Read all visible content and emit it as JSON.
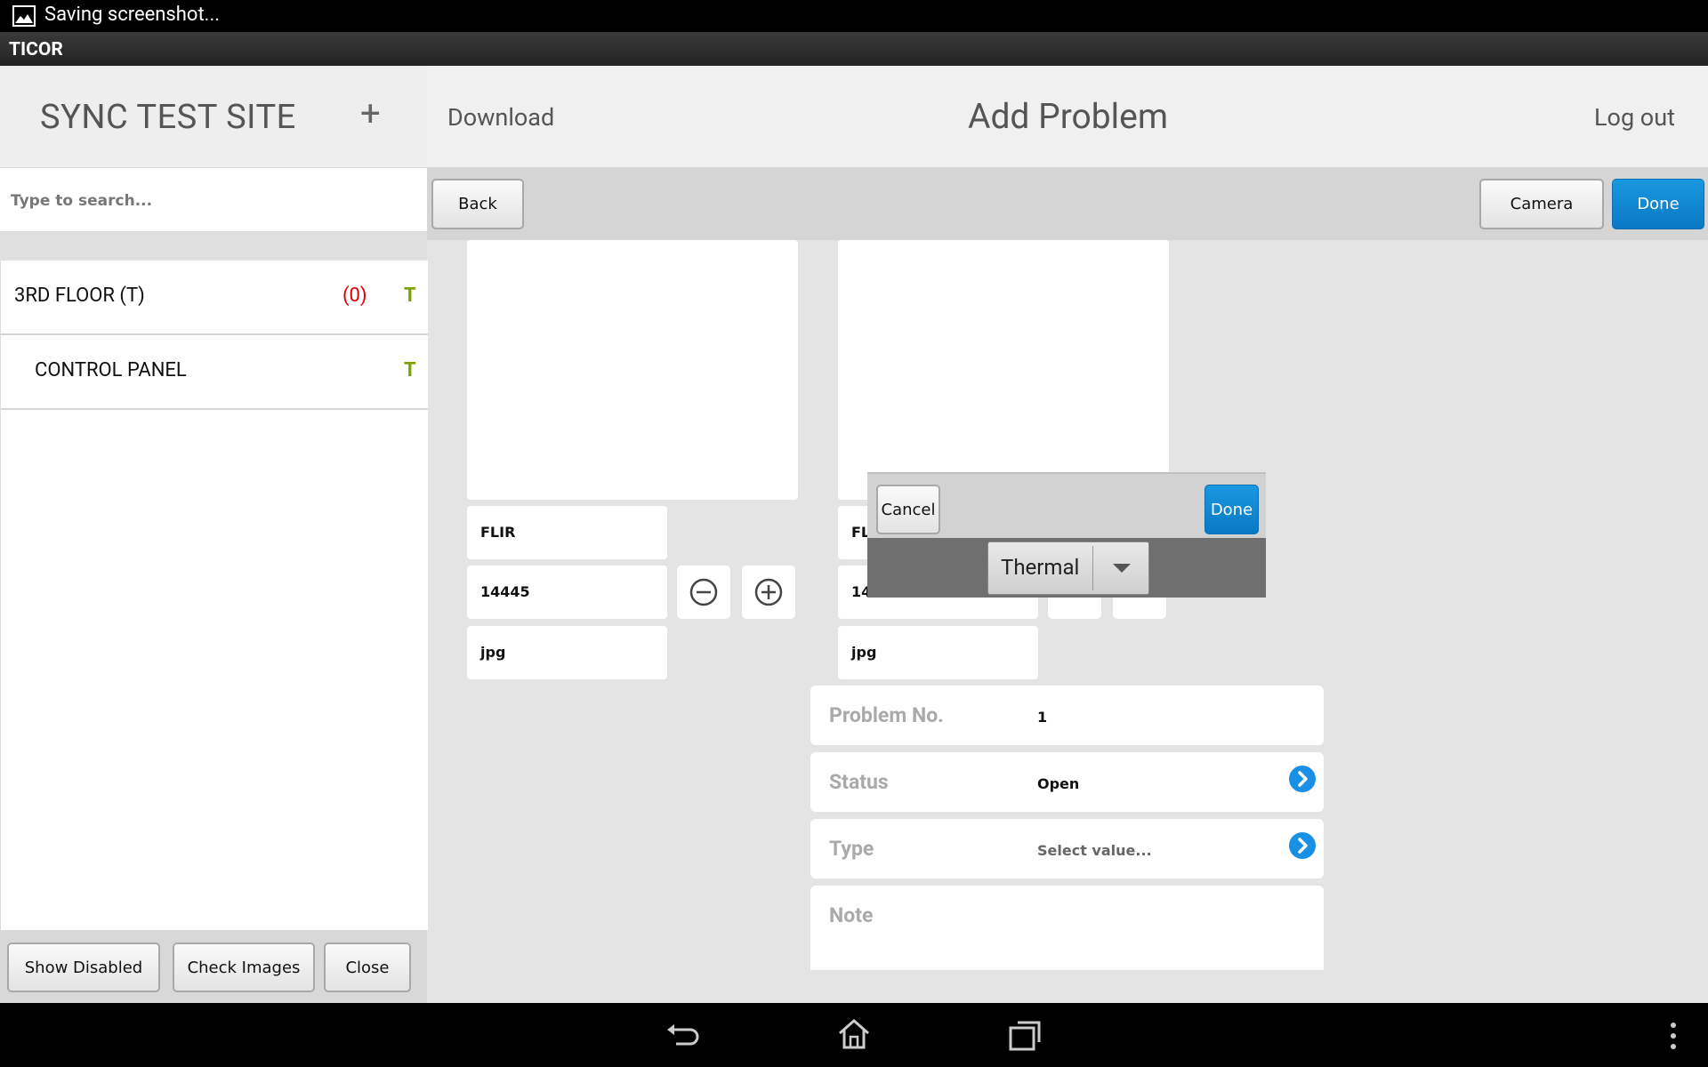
{
  "status_bar": {
    "text": "Saving screenshot..."
  },
  "app": {
    "title": "TICOR"
  },
  "sidebar": {
    "site_title": "SYNC TEST SITE",
    "add_label": "+",
    "search_placeholder": "Type to search...",
    "items": [
      {
        "label": "3RD FLOOR (T)",
        "count": "(0)",
        "flag": "T"
      },
      {
        "label": "CONTROL PANEL",
        "flag": "T"
      }
    ],
    "footer": {
      "show_disabled": "Show Disabled",
      "check_images": "Check Images",
      "close": "Close"
    }
  },
  "header": {
    "download": "Download",
    "title": "Add Problem",
    "logout": "Log out"
  },
  "toolbar": {
    "back": "Back",
    "camera": "Camera",
    "done": "Done"
  },
  "images": [
    {
      "brand": "FLIR",
      "number": "14445",
      "ext": "jpg"
    },
    {
      "brand": "FL",
      "number": "14",
      "ext": "jpg"
    }
  ],
  "form": {
    "problem_no": {
      "label": "Problem No.",
      "value": "1"
    },
    "status": {
      "label": "Status",
      "value": "Open"
    },
    "type": {
      "label": "Type",
      "placeholder": "Select value..."
    },
    "note": {
      "label": "Note"
    }
  },
  "picker": {
    "cancel": "Cancel",
    "done": "Done",
    "value": "Thermal"
  },
  "colors": {
    "accent": "#0a84d4",
    "count_red": "#e00000",
    "flag_green": "#7aa300"
  }
}
